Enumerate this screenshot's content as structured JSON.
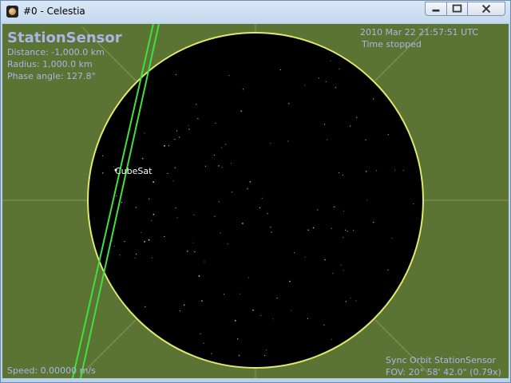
{
  "window": {
    "title": "#0 - Celestia"
  },
  "hud": {
    "object_name": "StationSensor",
    "distance": "Distance: -1,000.0 km",
    "radius": "Radius: 1,000.0 km",
    "phase": "Phase angle: 127.8°",
    "time": "2010 Mar 22 21:57:51 UTC",
    "time_status": "Time stopped",
    "speed": "Speed: 0.00000 m/s",
    "sync": "Sync Orbit StationSensor",
    "fov": "FOV: 20° 58' 42.0\" (0.79x)"
  },
  "labels": {
    "cubesat": "CubeSat"
  },
  "icons": [
    "celestia-app-icon",
    "minimize-icon",
    "maximize-icon",
    "close-icon"
  ],
  "colors": {
    "background": "#5c7433",
    "disk": "#000000",
    "disk_outline": "#dfe96e",
    "orbit_lines": "#40e040",
    "hud_text": "#a9b6e8"
  }
}
